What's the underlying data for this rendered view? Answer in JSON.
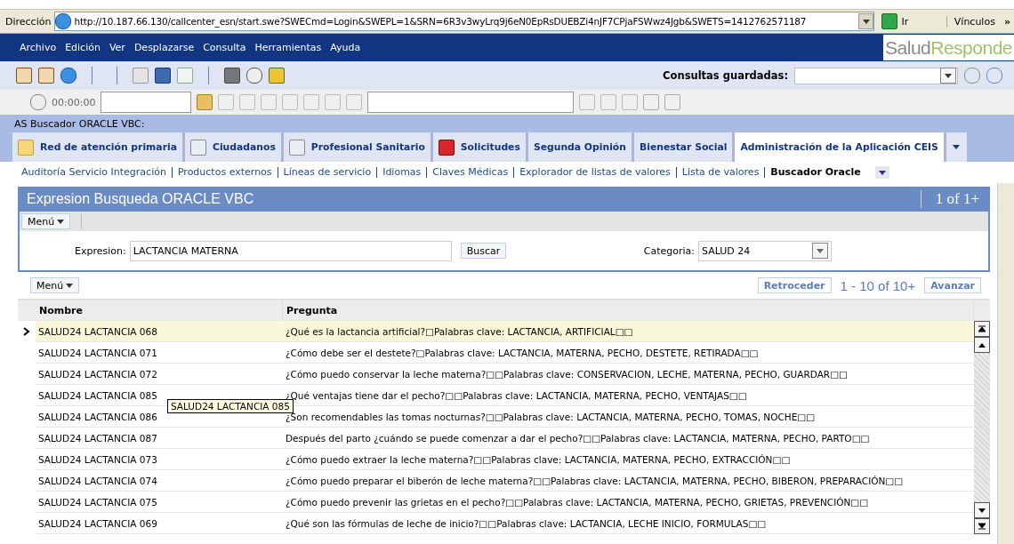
{
  "address_bar": {
    "label": "Dirección",
    "url": "http://10.187.66.130/callcenter_esn/start.swe?SWECmd=Login&SWEPL=1&SRN=6R3v3wyLrq9j6eN0EpRsDUEBZi4nJF7CPjaFSWwz4Jgb&SWETS=1412762571187",
    "go": "Ir",
    "links": "Vínculos",
    "more": "»"
  },
  "menu": [
    "Archivo",
    "Edición",
    "Ver",
    "Desplazarse",
    "Consulta",
    "Herramientas",
    "Ayuda"
  ],
  "logo": {
    "first": "Salud",
    "second": "Responde"
  },
  "saved_queries": {
    "label": "Consultas guardadas:"
  },
  "timer": "00:00:00",
  "breadcrumb": "AS Buscador ORACLE VBC:",
  "tabs": [
    {
      "label": "Red de atención primaria",
      "selected": false
    },
    {
      "label": "Ciudadanos",
      "selected": false
    },
    {
      "label": "Profesional Sanitario",
      "selected": false
    },
    {
      "label": "Solicitudes",
      "selected": false
    },
    {
      "label": "Segunda Opinión",
      "selected": false
    },
    {
      "label": "Bienestar Social",
      "selected": false
    },
    {
      "label": "Administración de la Aplicación CEIS",
      "selected": true
    }
  ],
  "subnav": [
    {
      "label": "Auditoría Servicio Integración",
      "selected": false
    },
    {
      "label": "Productos externos",
      "selected": false
    },
    {
      "label": "Líneas de servicio",
      "selected": false
    },
    {
      "label": "Idiomas",
      "selected": false
    },
    {
      "label": "Claves Médicas",
      "selected": false
    },
    {
      "label": "Explorador de listas de valores",
      "selected": false
    },
    {
      "label": "Lista de valores",
      "selected": false
    },
    {
      "label": "Buscador Oracle",
      "selected": true
    }
  ],
  "panel": {
    "title": "Expresion Busqueda ORACLE VBC",
    "count": "1 of 1+",
    "menu": "Menú",
    "expression": {
      "label": "Expresion:",
      "value": "LACTANCIA MATERNA"
    },
    "search": "Buscar",
    "category": {
      "label": "Categoria:",
      "value": "SALUD 24"
    }
  },
  "list": {
    "menu": "Menú",
    "prev": "Retroceder",
    "range": "1 - 10 of 10+",
    "next": "Avanzar",
    "columns": [
      "Nombre",
      "Pregunta"
    ],
    "rows": [
      {
        "nombre": "SALUD24 LACTANCIA 068",
        "pregunta": "¿Qué es la lactancia artificial?□Palabras clave: LACTANCIA, ARTIFICIAL□□",
        "selected": true
      },
      {
        "nombre": "SALUD24 LACTANCIA 071",
        "pregunta": "¿Cómo debe ser el destete?□Palabras clave: LACTANCIA, MATERNA, PECHO, DESTETE, RETIRADA□□",
        "selected": false
      },
      {
        "nombre": "SALUD24 LACTANCIA 072",
        "pregunta": "¿Cómo puedo conservar la leche materna?□□Palabras clave: CONSERVACION, LECHE, MATERNA, PECHO, GUARDAR□□",
        "selected": false
      },
      {
        "nombre": "SALUD24 LACTANCIA 085",
        "pregunta": "¿Qué ventajas tiene dar el pecho?□□Palabras clave: LACTANCIA, MATERNA, PECHO, VENTAJAS□□",
        "selected": false
      },
      {
        "nombre": "SALUD24 LACTANCIA 086",
        "pregunta": "¿Son recomendables las tomas nocturnas?□□Palabras clave: LACTANCIA, MATERNA, PECHO, TOMAS, NOCHE□□",
        "selected": false
      },
      {
        "nombre": "SALUD24 LACTANCIA 087",
        "pregunta": "Después del parto ¿cuándo se puede comenzar a dar el pecho?□□Palabras clave: LACTANCIA, MATERNA, PECHO, PARTO□□",
        "selected": false
      },
      {
        "nombre": "SALUD24 LACTANCIA 073",
        "pregunta": "¿Cómo puedo extraer la leche materna?□□Palabras clave: LACTANCIA, MATERNA, PECHO, EXTRACCIÓN□□",
        "selected": false
      },
      {
        "nombre": "SALUD24 LACTANCIA 074",
        "pregunta": "¿Cómo puedo preparar el biberón de leche materna?□□Palabras clave: LACTANCIA, MATERNA, PECHO, BIBERON, PREPARACIÓN□□",
        "selected": false
      },
      {
        "nombre": "SALUD24 LACTANCIA 075",
        "pregunta": "¿Cómo puedo prevenir las grietas en el pecho?□□Palabras clave: LACTANCIA, MATERNA, PECHO, GRIETAS, PREVENCIÓN□□",
        "selected": false
      },
      {
        "nombre": "SALUD24 LACTANCIA 069",
        "pregunta": "¿Qué son las fórmulas de leche de inicio?□□Palabras clave: LACTANCIA, LECHE INICIO, FORMULAS□□",
        "selected": false
      }
    ]
  },
  "tooltip": "SALUD24 LACTANCIA 085"
}
